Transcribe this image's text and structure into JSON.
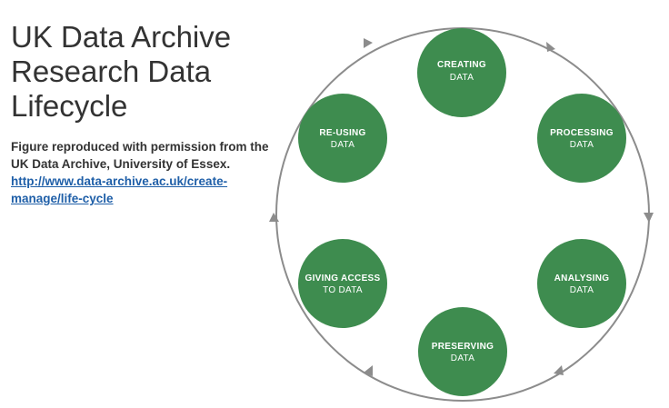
{
  "title": {
    "line1": "UK Data Archive",
    "line2": "Research Data",
    "line3": "Lifecycle"
  },
  "credit": {
    "line1": "Figure reproduced with permission from the",
    "line2": "UK Data Archive, University of Essex.",
    "link_line1": "http://www.data-archive.ac.uk/create-",
    "link_line2": "manage/life-cycle"
  },
  "stages": [
    {
      "line1": "CREATING",
      "line2": "DATA"
    },
    {
      "line1": "PROCESSING",
      "line2": "DATA"
    },
    {
      "line1": "ANALYSING",
      "line2": "DATA"
    },
    {
      "line1": "PRESERVING",
      "line2": "DATA"
    },
    {
      "line1": "GIVING ACCESS",
      "line2": "TO DATA"
    },
    {
      "line1": "RE-USING",
      "line2": "DATA"
    }
  ],
  "colors": {
    "stage_fill": "#3e8c4f",
    "ring": "#8c8c8c",
    "title_text": "#333333",
    "link": "#1f5fa8"
  }
}
